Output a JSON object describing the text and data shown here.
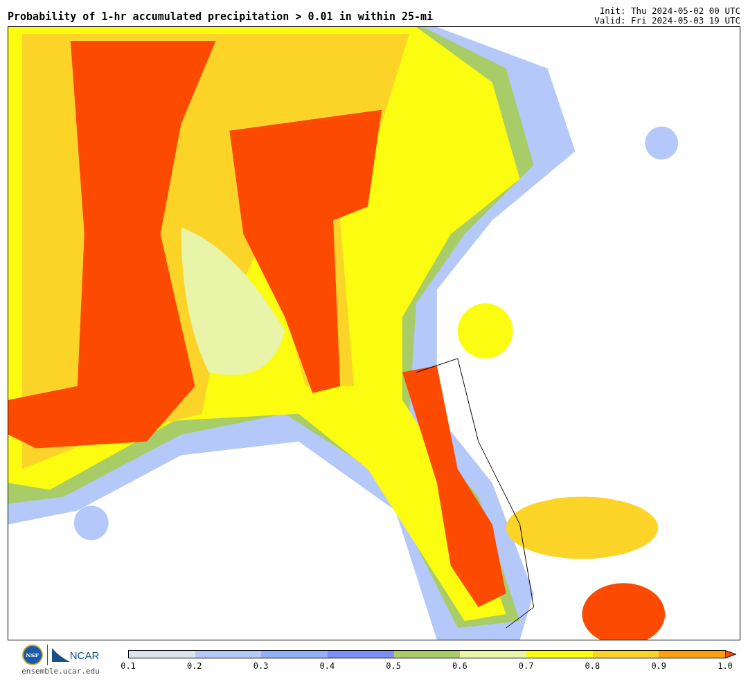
{
  "title": "Probability of 1-hr accumulated precipitation > 0.01 in within 25-mi",
  "init": "Init: Thu 2024-05-02 00 UTC",
  "valid": "Valid: Fri 2024-05-03 19 UTC",
  "logos": {
    "nsf": "NSF",
    "ncar": "NCAR",
    "site": "ensemble.ucar.edu"
  },
  "colorbar": {
    "bins": [
      {
        "color": "#d9e4ec"
      },
      {
        "color": "#b4c8fa"
      },
      {
        "color": "#90b0fa"
      },
      {
        "color": "#7890f8"
      },
      {
        "color": "#a8cc68"
      },
      {
        "color": "#e8f4a8"
      },
      {
        "color": "#fcfc10"
      },
      {
        "color": "#fcd428"
      },
      {
        "color": "#fca010"
      },
      {
        "kind": "extend",
        "color": "#fc4a00"
      }
    ],
    "ticks": [
      "0.1",
      "0.2",
      "0.3",
      "0.4",
      "0.5",
      "0.6",
      "0.7",
      "0.8",
      "0.9",
      "1.0"
    ]
  }
}
